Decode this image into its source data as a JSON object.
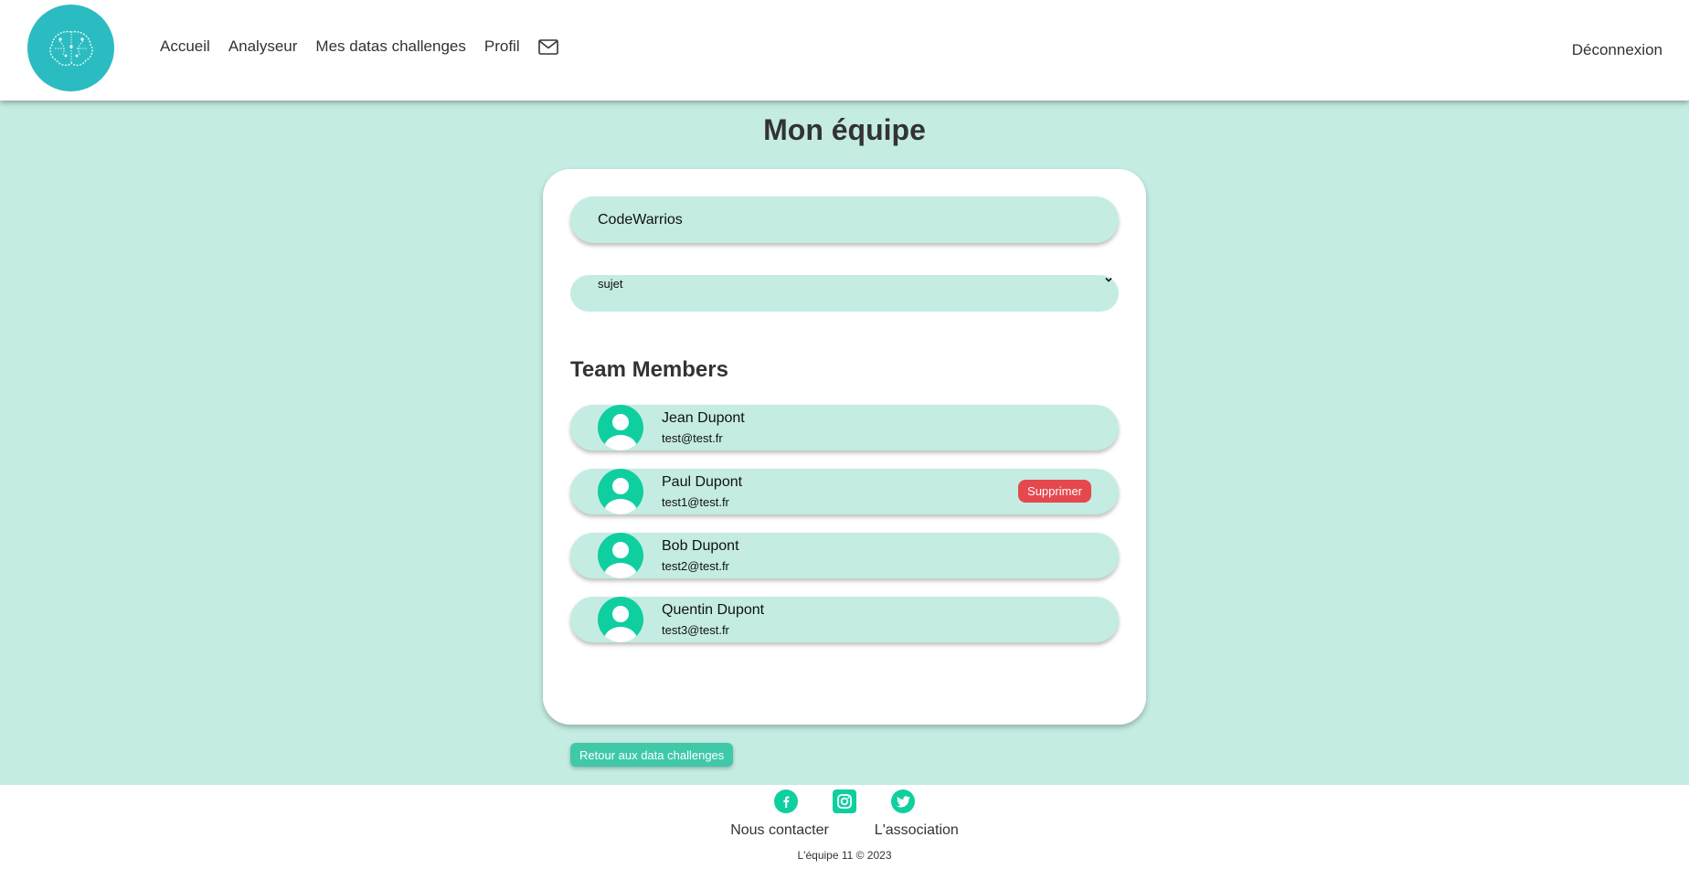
{
  "header": {
    "nav": [
      "Accueil",
      "Analyseur",
      "Mes datas challenges",
      "Profil"
    ],
    "logout": "Déconnexion",
    "icons": {
      "logo": "brain-logo-icon",
      "mail": "mail-icon"
    }
  },
  "page": {
    "title": "Mon équipe"
  },
  "team": {
    "name": "CodeWarrios",
    "subject": "sujet"
  },
  "members": {
    "title": "Team Members",
    "items": [
      {
        "name": "Jean Dupont",
        "email": "test@test.fr"
      },
      {
        "name": "Paul Dupont",
        "email": "test1@test.fr",
        "action": "Supprimer"
      },
      {
        "name": "Bob Dupont",
        "email": "test2@test.fr"
      },
      {
        "name": "Quentin Dupont",
        "email": "test3@test.fr"
      }
    ]
  },
  "back_button": "Retour aux data challenges",
  "footer": {
    "socials": [
      "facebook-icon",
      "instagram-icon",
      "twitter-icon"
    ],
    "links": [
      "Nous contacter",
      "L'association"
    ],
    "copyright": "L'équipe 11 © 2023"
  },
  "colors": {
    "background": "#c4ece2",
    "accent": "#0fcf9f",
    "logo": "#2bbcc1",
    "danger": "#e5484d",
    "button": "#3fc9a8"
  }
}
